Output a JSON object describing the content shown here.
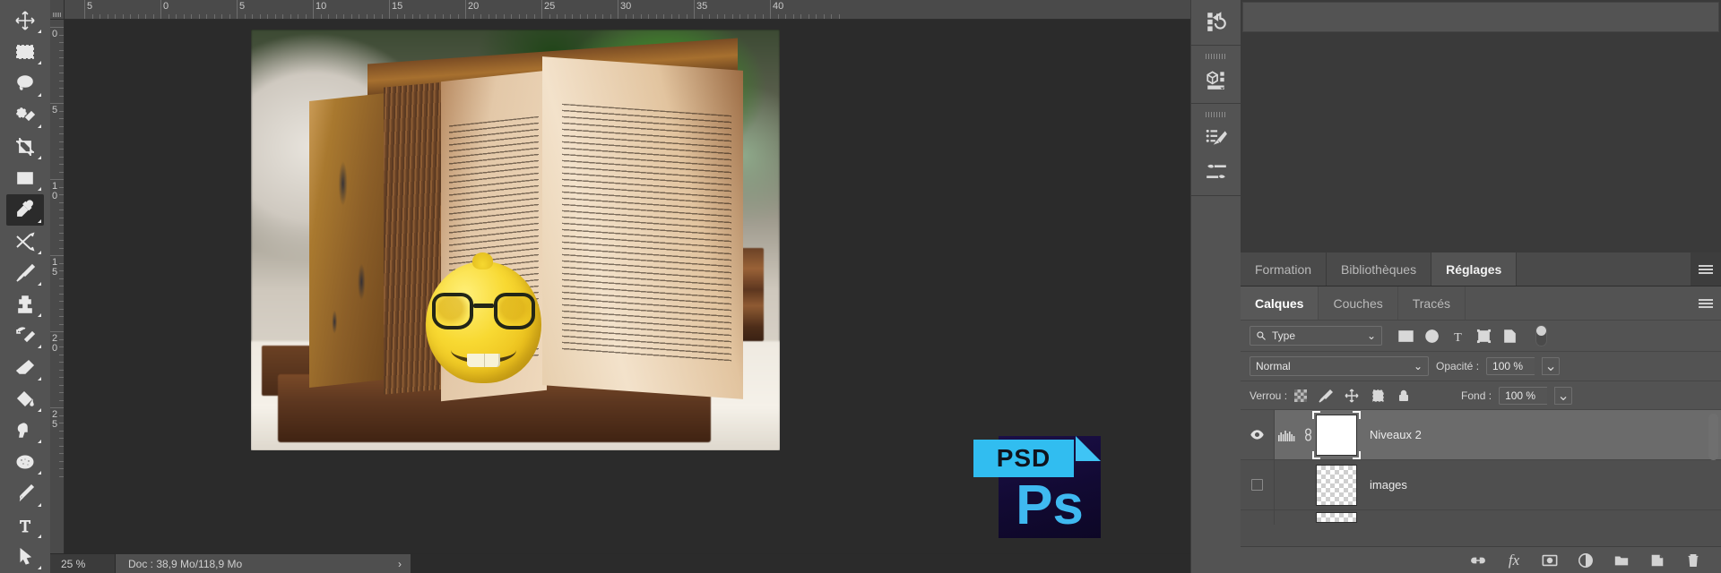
{
  "app": {
    "name": "Adobe Photoshop",
    "locale": "fr"
  },
  "toolbar": {
    "tools": [
      {
        "name": "move-tool",
        "icon": "move-icon",
        "active": false
      },
      {
        "name": "marquee-tool",
        "icon": "rectangular-marquee-icon",
        "active": false
      },
      {
        "name": "lasso-tool",
        "icon": "lasso-icon",
        "active": false
      },
      {
        "name": "quick-selection-tool",
        "icon": "quick-selection-icon",
        "active": false
      },
      {
        "name": "crop-tool",
        "icon": "crop-icon",
        "active": false
      },
      {
        "name": "frame-tool",
        "icon": "frame-icon",
        "active": false
      },
      {
        "name": "eyedropper-tool",
        "icon": "eyedropper-icon",
        "active": true
      },
      {
        "name": "healing-brush-tool",
        "icon": "healing-brush-icon",
        "active": false
      },
      {
        "name": "brush-tool",
        "icon": "brush-icon",
        "active": false
      },
      {
        "name": "clone-stamp-tool",
        "icon": "clone-stamp-icon",
        "active": false
      },
      {
        "name": "history-brush-tool",
        "icon": "history-brush-icon",
        "active": false
      },
      {
        "name": "eraser-tool",
        "icon": "eraser-icon",
        "active": false
      },
      {
        "name": "gradient-tool",
        "icon": "paint-bucket-icon",
        "active": false
      },
      {
        "name": "dodge-tool",
        "icon": "dodge-icon",
        "active": false
      },
      {
        "name": "sponge-tool",
        "icon": "sponge-icon",
        "active": false
      },
      {
        "name": "pen-tool",
        "icon": "pen-icon",
        "active": false
      },
      {
        "name": "type-tool",
        "icon": "type-icon",
        "active": false
      },
      {
        "name": "path-selection-tool",
        "icon": "path-selection-icon",
        "active": false
      }
    ]
  },
  "rulers": {
    "horizontal_labels": [
      "5",
      "0",
      "5",
      "10",
      "15",
      "20",
      "25",
      "30",
      "35",
      "40"
    ],
    "vertical_labels": [
      "0",
      "5",
      "10",
      "15",
      "20",
      "25"
    ],
    "unit": "cm"
  },
  "canvas": {
    "document_description": "Open antique book with yellow lemon wearing nerd glasses and smiling face, blurred green plant background",
    "psd_badge": {
      "tag": "PSD",
      "mark": "Ps"
    }
  },
  "status_bar": {
    "zoom": "25 %",
    "doc_info": "Doc : 38,9 Mo/118,9 Mo",
    "arrow": "›"
  },
  "right_rail": {
    "groups": [
      {
        "items": [
          {
            "name": "history-actions-icon"
          }
        ]
      },
      {
        "items": [
          {
            "name": "libraries-3d-icon"
          }
        ]
      },
      {
        "items": [
          {
            "name": "brush-presets-icon"
          },
          {
            "name": "brush-settings-icon"
          }
        ]
      }
    ]
  },
  "top_panel": {
    "tabs": [
      {
        "label": "Formation",
        "active": false
      },
      {
        "label": "Bibliothèques",
        "active": false
      },
      {
        "label": "Réglages",
        "active": true
      }
    ],
    "menu_icon": "panel-menu-icon"
  },
  "layers_panel": {
    "tabs": [
      {
        "label": "Calques",
        "active": true
      },
      {
        "label": "Couches",
        "active": false
      },
      {
        "label": "Tracés",
        "active": false
      }
    ],
    "menu_icon": "panel-menu-icon",
    "filter": {
      "label": "Type",
      "icon": "search-icon",
      "caret": "⌄",
      "type_icons": [
        {
          "name": "filter-pixel-icon"
        },
        {
          "name": "filter-adjustment-icon"
        },
        {
          "name": "filter-type-icon"
        },
        {
          "name": "filter-shape-icon"
        },
        {
          "name": "filter-smart-object-icon"
        }
      ],
      "toggle": {
        "name": "filter-enable-toggle",
        "on": true
      }
    },
    "blend": {
      "mode": "Normal",
      "caret": "⌄"
    },
    "opacity": {
      "label": "Opacité :",
      "value": "100 %",
      "caret": "⌄"
    },
    "lock": {
      "label": "Verrou :",
      "icons": [
        {
          "name": "lock-transparent-pixels-icon"
        },
        {
          "name": "lock-image-pixels-icon"
        },
        {
          "name": "lock-position-icon"
        },
        {
          "name": "lock-artboard-icon"
        },
        {
          "name": "lock-all-icon"
        }
      ]
    },
    "fill": {
      "label": "Fond :",
      "value": "100 %",
      "caret": "⌄"
    },
    "layers": [
      {
        "name": "Niveaux 2",
        "visible": true,
        "selected": true,
        "kind": "adjustment-levels",
        "has_link": true,
        "thumb": "white-mask"
      },
      {
        "name": "images",
        "visible": false,
        "selected": false,
        "kind": "pixel",
        "has_link": false,
        "thumb": "transparent-checker"
      }
    ],
    "footer_icons": [
      {
        "name": "link-layers-icon"
      },
      {
        "name": "layer-style-fx-icon",
        "label": "fx"
      },
      {
        "name": "add-layer-mask-icon"
      },
      {
        "name": "new-adjustment-layer-icon"
      },
      {
        "name": "new-group-icon"
      },
      {
        "name": "new-layer-icon"
      },
      {
        "name": "delete-layer-icon"
      }
    ]
  },
  "colors": {
    "panel_bg": "#535353",
    "canvas_bg": "#2b2b2b",
    "selected_layer": "#6b6b6b",
    "accent_psd": "#31bdf0"
  }
}
